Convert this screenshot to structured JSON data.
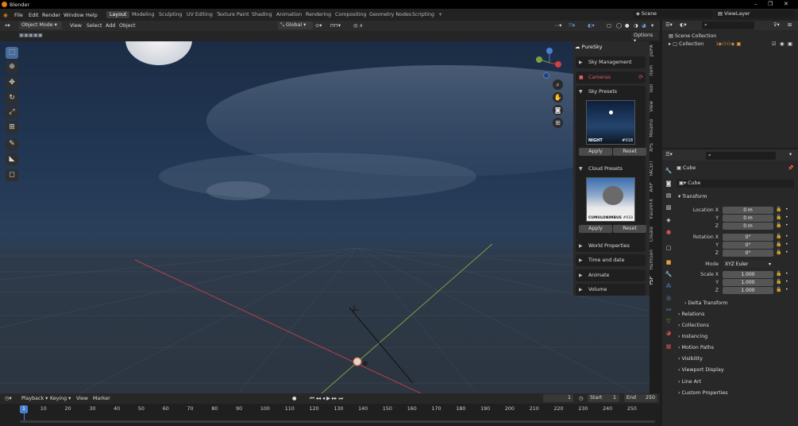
{
  "app": {
    "title": "Blender",
    "brand_color": "#e87d0d"
  },
  "menus": [
    "File",
    "Edit",
    "Render",
    "Window",
    "Help"
  ],
  "workspaces": [
    "Layout",
    "Modeling",
    "Sculpting",
    "UV Editing",
    "Texture Paint",
    "Shading",
    "Animation",
    "Rendering",
    "Compositing",
    "Geometry Nodes",
    "Scripting",
    "+"
  ],
  "scene": {
    "label": "Scene",
    "view_layer": "ViewLayer"
  },
  "viewport_header": {
    "mode": "Object Mode",
    "menus": [
      "View",
      "Select",
      "Add",
      "Object"
    ],
    "transform": "Global",
    "options": "Options"
  },
  "npanel": {
    "title": "PureSky",
    "sections": {
      "sky_management": "Sky Management",
      "cameras": "Cameras",
      "sky_presets": "Sky Presets",
      "sky_preset_name": "NIGHT",
      "sky_preset_num": "#018",
      "cloud_presets": "Cloud Presets",
      "cloud_preset_name": "CUMULONIMBUS",
      "cloud_preset_num": "#018",
      "apply": "Apply",
      "reset": "Reset",
      "world_properties": "World Properties",
      "time_and_date": "Time and date",
      "animate": "Animate",
      "volume": "Volume"
    }
  },
  "vtabs": [
    "pUPA",
    "Item",
    "Tool",
    "View",
    "Mixamo",
    "XPS",
    "FACEIT",
    "ARP",
    "TraceVFX",
    "Create",
    "HumGen",
    "PSP"
  ],
  "outliner": {
    "scene_collection": "Scene Collection",
    "collection": "Collection"
  },
  "properties": {
    "object_name": "Cube",
    "data_name": "Cube",
    "transform": "Transform",
    "location": {
      "label": "Location X",
      "y": "Y",
      "z": "Z",
      "values": [
        "0 m",
        "0 m",
        "0 m"
      ]
    },
    "rotation": {
      "label": "Rotation X",
      "y": "Y",
      "z": "Z",
      "values": [
        "0°",
        "0°",
        "0°"
      ]
    },
    "mode_label": "Mode",
    "mode_value": "XYZ Euler",
    "scale": {
      "label": "Scale X",
      "y": "Y",
      "z": "Z",
      "values": [
        "1.000",
        "1.000",
        "1.000"
      ]
    },
    "delta_transform": "Delta Transform",
    "sections": [
      "Relations",
      "Collections",
      "Instancing",
      "Motion Paths",
      "Visibility",
      "Viewport Display",
      "Line Art",
      "Custom Properties"
    ]
  },
  "timeline": {
    "menus": [
      "Playback",
      "Keying",
      "View",
      "Marker"
    ],
    "current_frame": "1",
    "start_label": "Start",
    "start": "1",
    "end_label": "End",
    "end": "250",
    "ticks": [
      "1",
      "10",
      "20",
      "30",
      "40",
      "50",
      "60",
      "70",
      "80",
      "90",
      "100",
      "110",
      "120",
      "130",
      "140",
      "150",
      "160",
      "170",
      "180",
      "190",
      "200",
      "210",
      "220",
      "230",
      "240",
      "250"
    ]
  }
}
